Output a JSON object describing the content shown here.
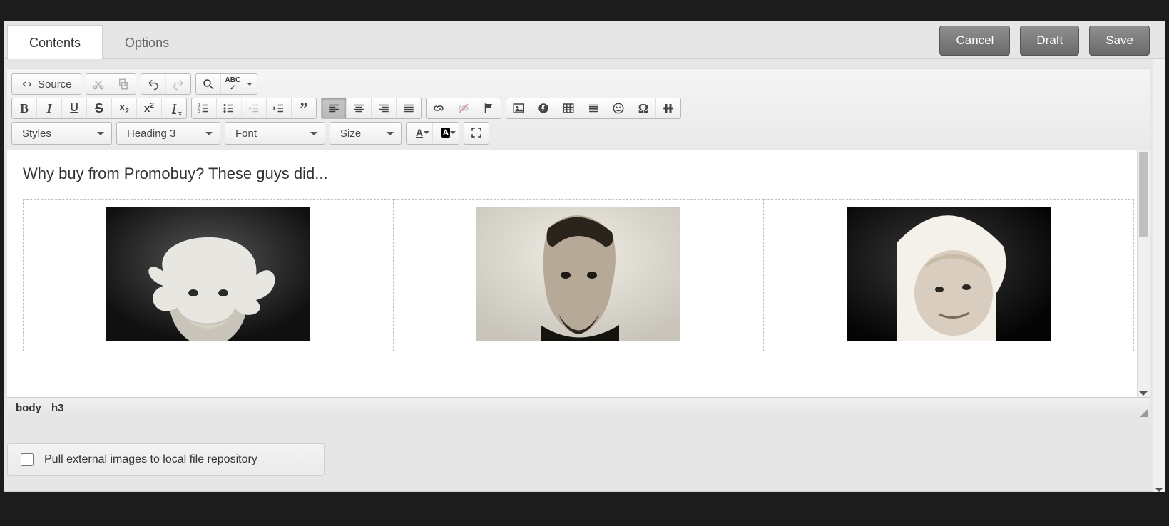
{
  "tabs": {
    "contents": "Contents",
    "options": "Options",
    "active": "contents"
  },
  "actions": {
    "cancel": "Cancel",
    "draft": "Draft",
    "save": "Save"
  },
  "toolbar": {
    "source": "Source",
    "styles": "Styles",
    "format": "Heading 3",
    "font": "Font",
    "size": "Size"
  },
  "content": {
    "heading": "Why buy from Promobuy? These guys did...",
    "images": [
      "einstein",
      "lincoln",
      "victoria"
    ]
  },
  "path": {
    "el0": "body",
    "el1": "h3"
  },
  "option": {
    "pull_label": "Pull external images to local file repository",
    "checked": false
  }
}
